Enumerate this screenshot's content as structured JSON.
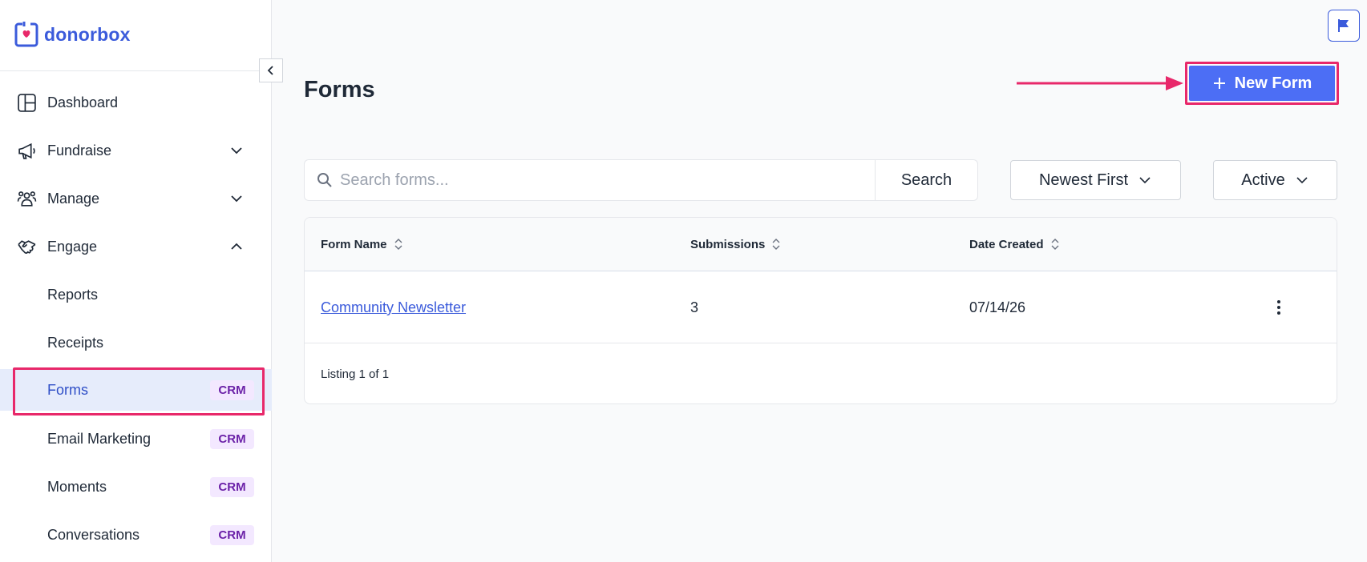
{
  "brand": {
    "name": "donorbox",
    "color": "#3b5bdb"
  },
  "sidebar": {
    "collapse_icon": "chevron-left-icon",
    "nav": [
      {
        "label": "Dashboard",
        "icon": "dashboard-icon"
      },
      {
        "label": "Fundraise",
        "icon": "megaphone-icon",
        "expanded": false
      },
      {
        "label": "Manage",
        "icon": "people-icon",
        "expanded": false
      },
      {
        "label": "Engage",
        "icon": "handshake-icon",
        "expanded": true
      }
    ],
    "engage_items": [
      {
        "label": "Reports",
        "badge": ""
      },
      {
        "label": "Receipts",
        "badge": ""
      },
      {
        "label": "Forms",
        "badge": "CRM",
        "active": true
      },
      {
        "label": "Email Marketing",
        "badge": "CRM"
      },
      {
        "label": "Moments",
        "badge": "CRM"
      },
      {
        "label": "Conversations",
        "badge": "CRM"
      }
    ]
  },
  "header": {
    "title": "Forms",
    "new_form_label": "New Form",
    "flag_icon": "flag-icon"
  },
  "toolbar": {
    "search_placeholder": "Search forms...",
    "search_value": "",
    "search_button": "Search",
    "sort_selected": "Newest First",
    "status_selected": "Active"
  },
  "table": {
    "columns": [
      "Form Name",
      "Submissions",
      "Date Created"
    ],
    "rows": [
      {
        "name": "Community Newsletter",
        "submissions": "3",
        "date_created": "07/14/26"
      }
    ],
    "footer": "Listing 1 of 1"
  },
  "colors": {
    "primary": "#4c6ef5",
    "highlight": "#e8286a",
    "crm_badge_bg": "#f3e8ff",
    "crm_badge_text": "#6b21a8"
  }
}
